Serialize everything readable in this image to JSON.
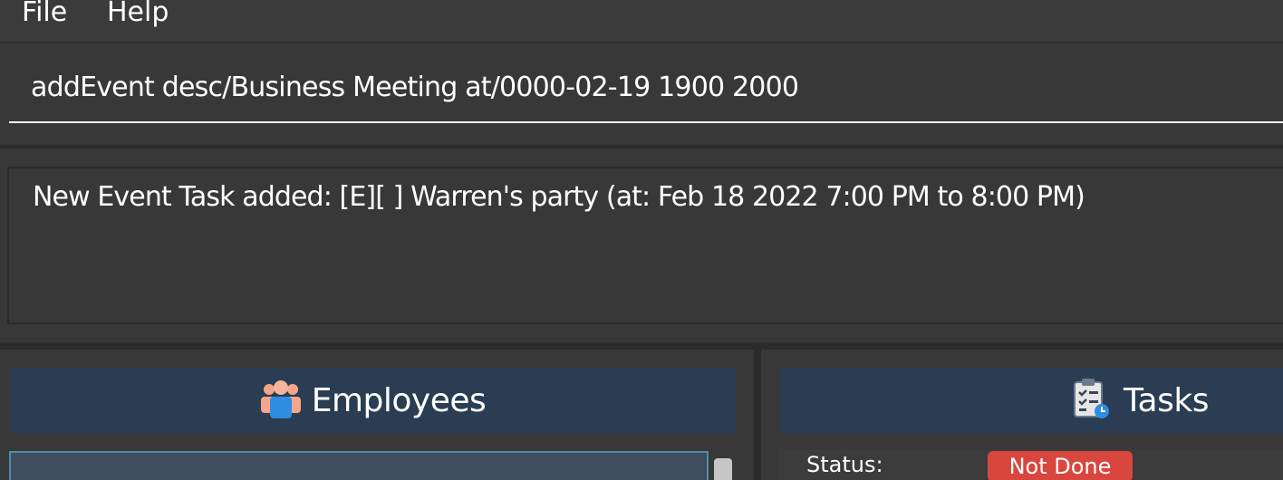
{
  "menu": {
    "file": "File",
    "help": "Help"
  },
  "command": {
    "value": "addEvent desc/Business Meeting at/0000-02-19 1900 2000"
  },
  "result": {
    "message": "New Event Task added: [E][ ] Warren's party (at: Feb 18 2022 7:00 PM to 8:00 PM)"
  },
  "employees": {
    "title": "Employees",
    "icon": "people-icon"
  },
  "tasks": {
    "title": "Tasks",
    "icon": "clipboard-checklist-icon",
    "first_task": {
      "status_label": "Status:",
      "status_value": "Not Done"
    }
  },
  "colors": {
    "background": "#3a3a3a",
    "header_bar": "#2b3d53",
    "status_not_done": "#d9463e",
    "selection_border": "#4a8fa8"
  }
}
